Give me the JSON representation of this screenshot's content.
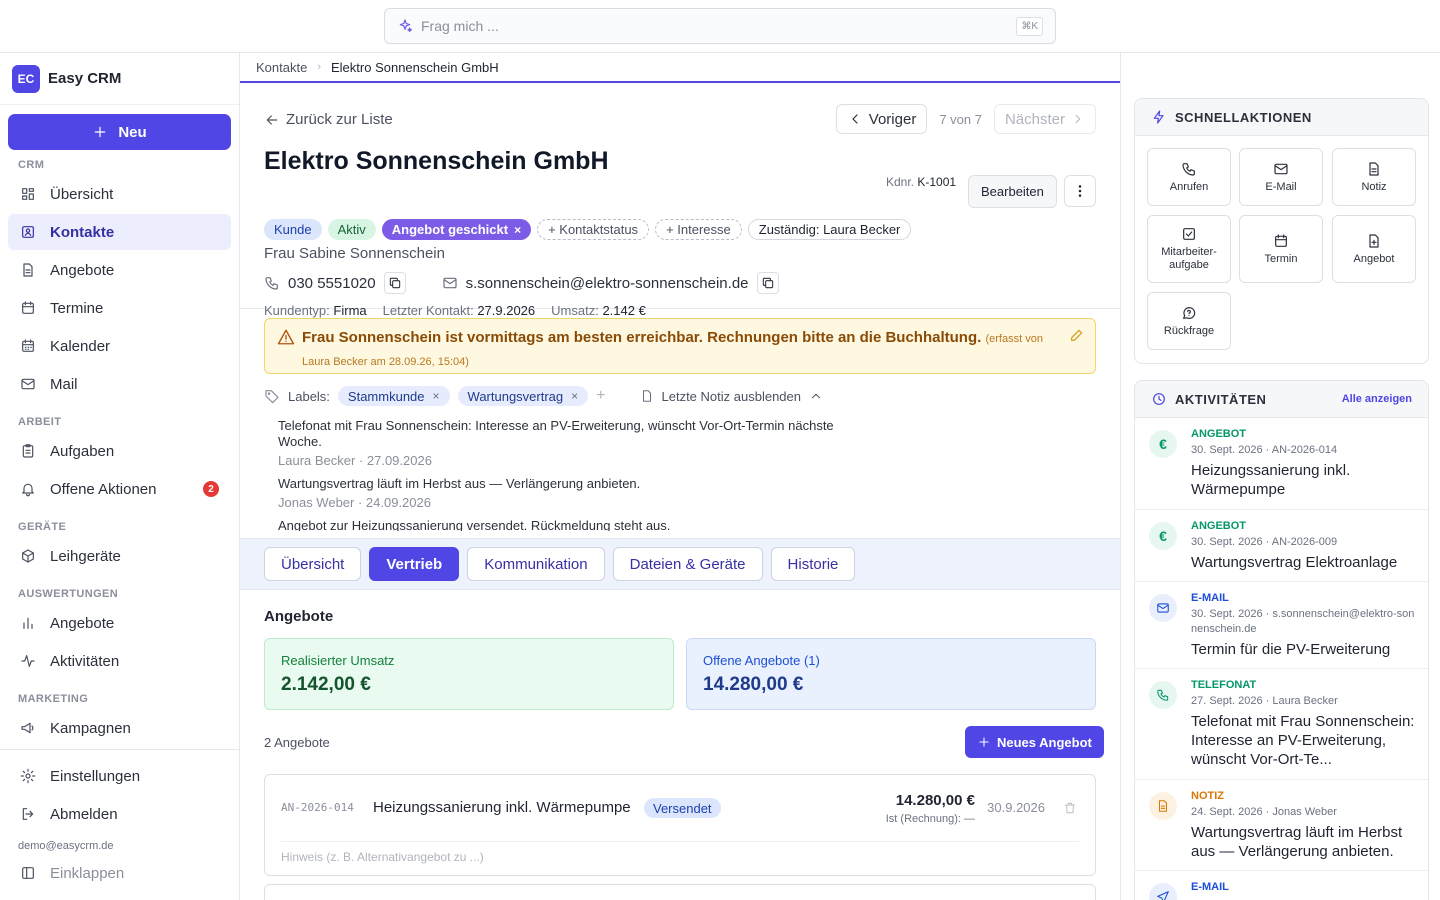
{
  "search": {
    "placeholder": "Frag mich ...",
    "shortcut": "⌘K"
  },
  "brand": {
    "initials": "EC",
    "name": "Easy CRM"
  },
  "sidebar": {
    "new_label": "Neu",
    "sections": {
      "crm": "CRM",
      "arbeit": "ARBEIT",
      "geraete": "GERÄTE",
      "auswertungen": "AUSWERTUNGEN",
      "marketing": "MARKETING"
    },
    "items": [
      "Übersicht",
      "Kontakte",
      "Angebote",
      "Termine",
      "Kalender",
      "Mail",
      "Aufgaben",
      "Offene Aktionen",
      "Leihgeräte",
      "Angebote",
      "Aktivitäten",
      "Kampagnen",
      "Einstellungen",
      "Abmelden",
      "Einklappen"
    ],
    "offene_badge": "2",
    "email": "demo@easycrm.de"
  },
  "breadcrumb": {
    "parent": "Kontakte",
    "current": "Elektro Sonnenschein GmbH"
  },
  "header": {
    "back": "Zurück zur Liste",
    "prev": "Voriger",
    "count": "7 von 7",
    "next": "Nächster",
    "title": "Elektro Sonnenschein GmbH",
    "kdnr_label": "Kdnr.",
    "kdnr": "K-1001",
    "edit": "Bearbeiten",
    "tags": {
      "kunde": "Kunde",
      "aktiv": "Aktiv",
      "angebot": "Angebot geschickt",
      "kontaktstatus": "+ Kontaktstatus",
      "interesse": "+ Interesse",
      "zustaendig": "Zuständig: Laura Becker"
    },
    "person": "Frau Sabine Sonnenschein",
    "phone": "030 5551020",
    "email": "s.sonnenschein@elektro-sonnenschein.de",
    "meta": {
      "kundentyp_l": "Kundentyp:",
      "kundentyp": "Firma",
      "kontakt_l": "Letzter Kontakt:",
      "kontakt": "27.9.2026",
      "umsatz_l": "Umsatz:",
      "umsatz": "2.142 €"
    }
  },
  "note": {
    "text": "Frau Sonnenschein ist vormittags am besten erreichbar. Rechnungen bitte an die Buchhaltung.",
    "meta": "(erfasst von Laura Becker am 28.09.26, 15:04)"
  },
  "labels": {
    "title": "Labels:",
    "items": [
      "Stammkunde",
      "Wartungsvertrag"
    ],
    "hide": "Letzte Notiz ausblenden"
  },
  "notes": [
    {
      "text": "Telefonat mit Frau Sonnenschein: Interesse an PV-Erweiterung, wünscht Vor-Ort-Termin nächste Woche.",
      "meta": "Laura Becker · 27.09.2026"
    },
    {
      "text": "Wartungsvertrag läuft im Herbst aus — Verlängerung anbieten.",
      "meta": "Jonas Weber · 24.09.2026"
    },
    {
      "text": "Angebot zur Heizungssanierung versendet. Rückmeldung steht aus.",
      "meta": ""
    }
  ],
  "tabs": [
    "Übersicht",
    "Vertrieb",
    "Kommunikation",
    "Dateien & Geräte",
    "Historie"
  ],
  "offers": {
    "title": "Angebote",
    "kpi1_label": "Realisierter Umsatz",
    "kpi1_value": "2.142,00 €",
    "kpi2_label": "Offene Angebote (1)",
    "kpi2_value": "14.280,00 €",
    "count": "2 Angebote",
    "new": "Neues Angebot",
    "item": {
      "id": "AN-2026-014",
      "name": "Heizungssanierung inkl. Wärmepumpe",
      "status": "Versendet",
      "amount": "14.280,00 €",
      "ist": "Ist (Rechnung): —",
      "date": "30.9.2026",
      "hint": "Hinweis (z. B. Alternativangebot zu ...)"
    }
  },
  "quick": {
    "title": "SCHNELLAKTIONEN",
    "buttons": [
      "Anrufen",
      "E-Mail",
      "Notiz",
      "Mitarbeiter-aufgabe",
      "Termin",
      "Angebot",
      "Rückfrage"
    ]
  },
  "activities": {
    "title": "AKTIVITÄTEN",
    "all": "Alle anzeigen",
    "items": [
      {
        "type": "ANGEBOT",
        "meta": "30. Sept. 2026 · AN-2026-014",
        "title": "Heizungssanierung inkl. Wärmepumpe",
        "color": "#059669"
      },
      {
        "type": "ANGEBOT",
        "meta": "30. Sept. 2026 · AN-2026-009",
        "title": "Wartungsvertrag Elektroanlage",
        "color": "#059669"
      },
      {
        "type": "E-MAIL",
        "meta": "30. Sept. 2026 · s.sonnenschein@elektro-sonnenschein.de",
        "title": "Termin für die PV-Erweiterung",
        "color": "#1d4ed8"
      },
      {
        "type": "TELEFONAT",
        "meta": "27. Sept. 2026 · Laura Becker",
        "title": "Telefonat mit Frau Sonnenschein: Interesse an PV-Erweiterung, wünscht Vor-Ort-Te...",
        "color": "#059669"
      },
      {
        "type": "NOTIZ",
        "meta": "24. Sept. 2026 · Jonas Weber",
        "title": "Wartungsvertrag läuft im Herbst aus — Verlängerung anbieten.",
        "color": "#d97706"
      },
      {
        "type": "E-MAIL",
        "meta": "",
        "title": "",
        "color": "#1d4ed8"
      }
    ]
  }
}
